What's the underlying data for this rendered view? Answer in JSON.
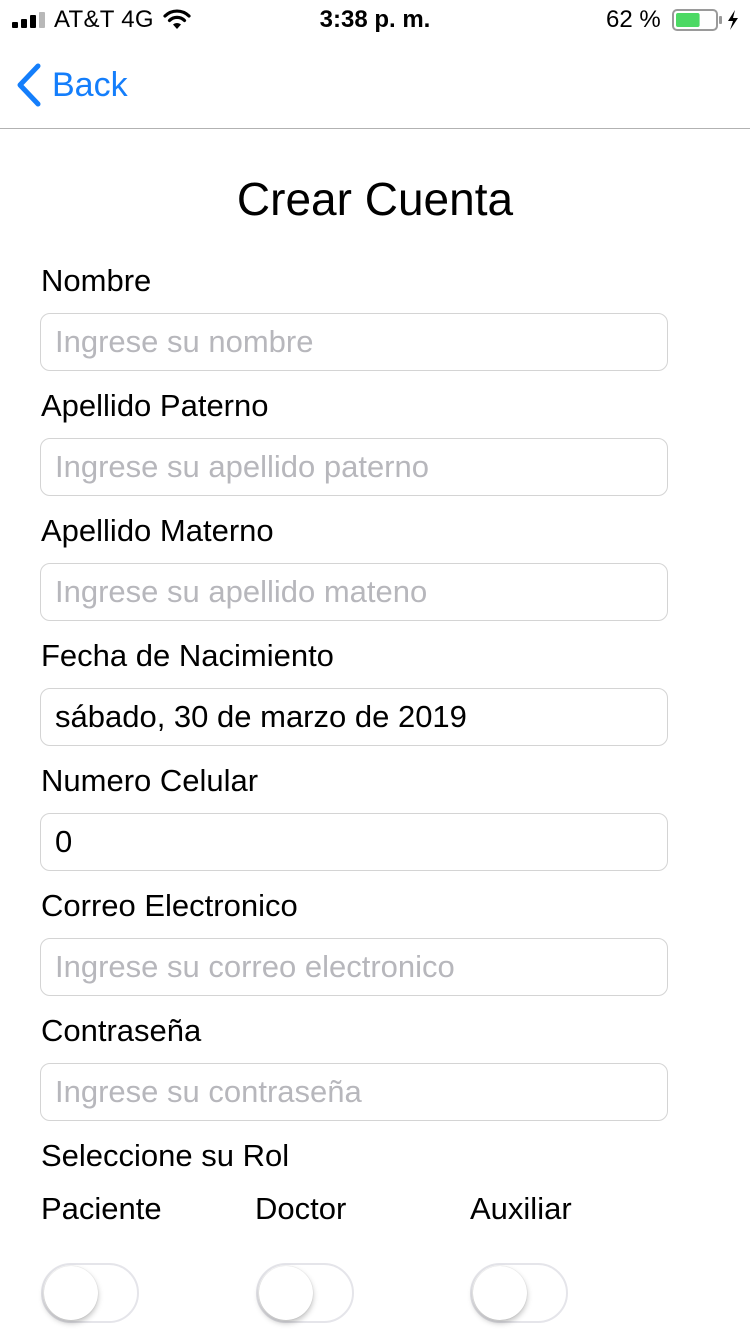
{
  "status_bar": {
    "carrier": "AT&T 4G",
    "time": "3:38 p. m.",
    "battery_percent": "62 %",
    "battery_level": 0.62,
    "icons": [
      "signal-bars-icon",
      "wifi-icon",
      "battery-icon",
      "charging-bolt-icon"
    ]
  },
  "nav": {
    "back_label": "Back",
    "back_icon": "chevron-left-icon",
    "accent_color": "#147efb"
  },
  "page": {
    "title": "Crear Cuenta"
  },
  "form": {
    "fields": [
      {
        "label": "Nombre",
        "value": "",
        "placeholder": "Ingrese su nombre"
      },
      {
        "label": "Apellido Paterno",
        "value": "",
        "placeholder": "Ingrese su apellido paterno"
      },
      {
        "label": "Apellido Materno",
        "value": "",
        "placeholder": "Ingrese su apellido mateno"
      },
      {
        "label": "Fecha de Nacimiento",
        "value": "sábado, 30 de marzo de 2019",
        "placeholder": ""
      },
      {
        "label": "Numero Celular",
        "value": "0",
        "placeholder": ""
      },
      {
        "label": "Correo Electronico",
        "value": "",
        "placeholder": "Ingrese su correo electronico"
      },
      {
        "label": "Contraseña",
        "value": "",
        "placeholder": "Ingrese su contraseña"
      }
    ],
    "role_section_label": "Seleccione su Rol",
    "roles": [
      {
        "label": "Paciente",
        "on": false
      },
      {
        "label": "Doctor",
        "on": false
      },
      {
        "label": "Auxiliar",
        "on": false
      }
    ]
  }
}
